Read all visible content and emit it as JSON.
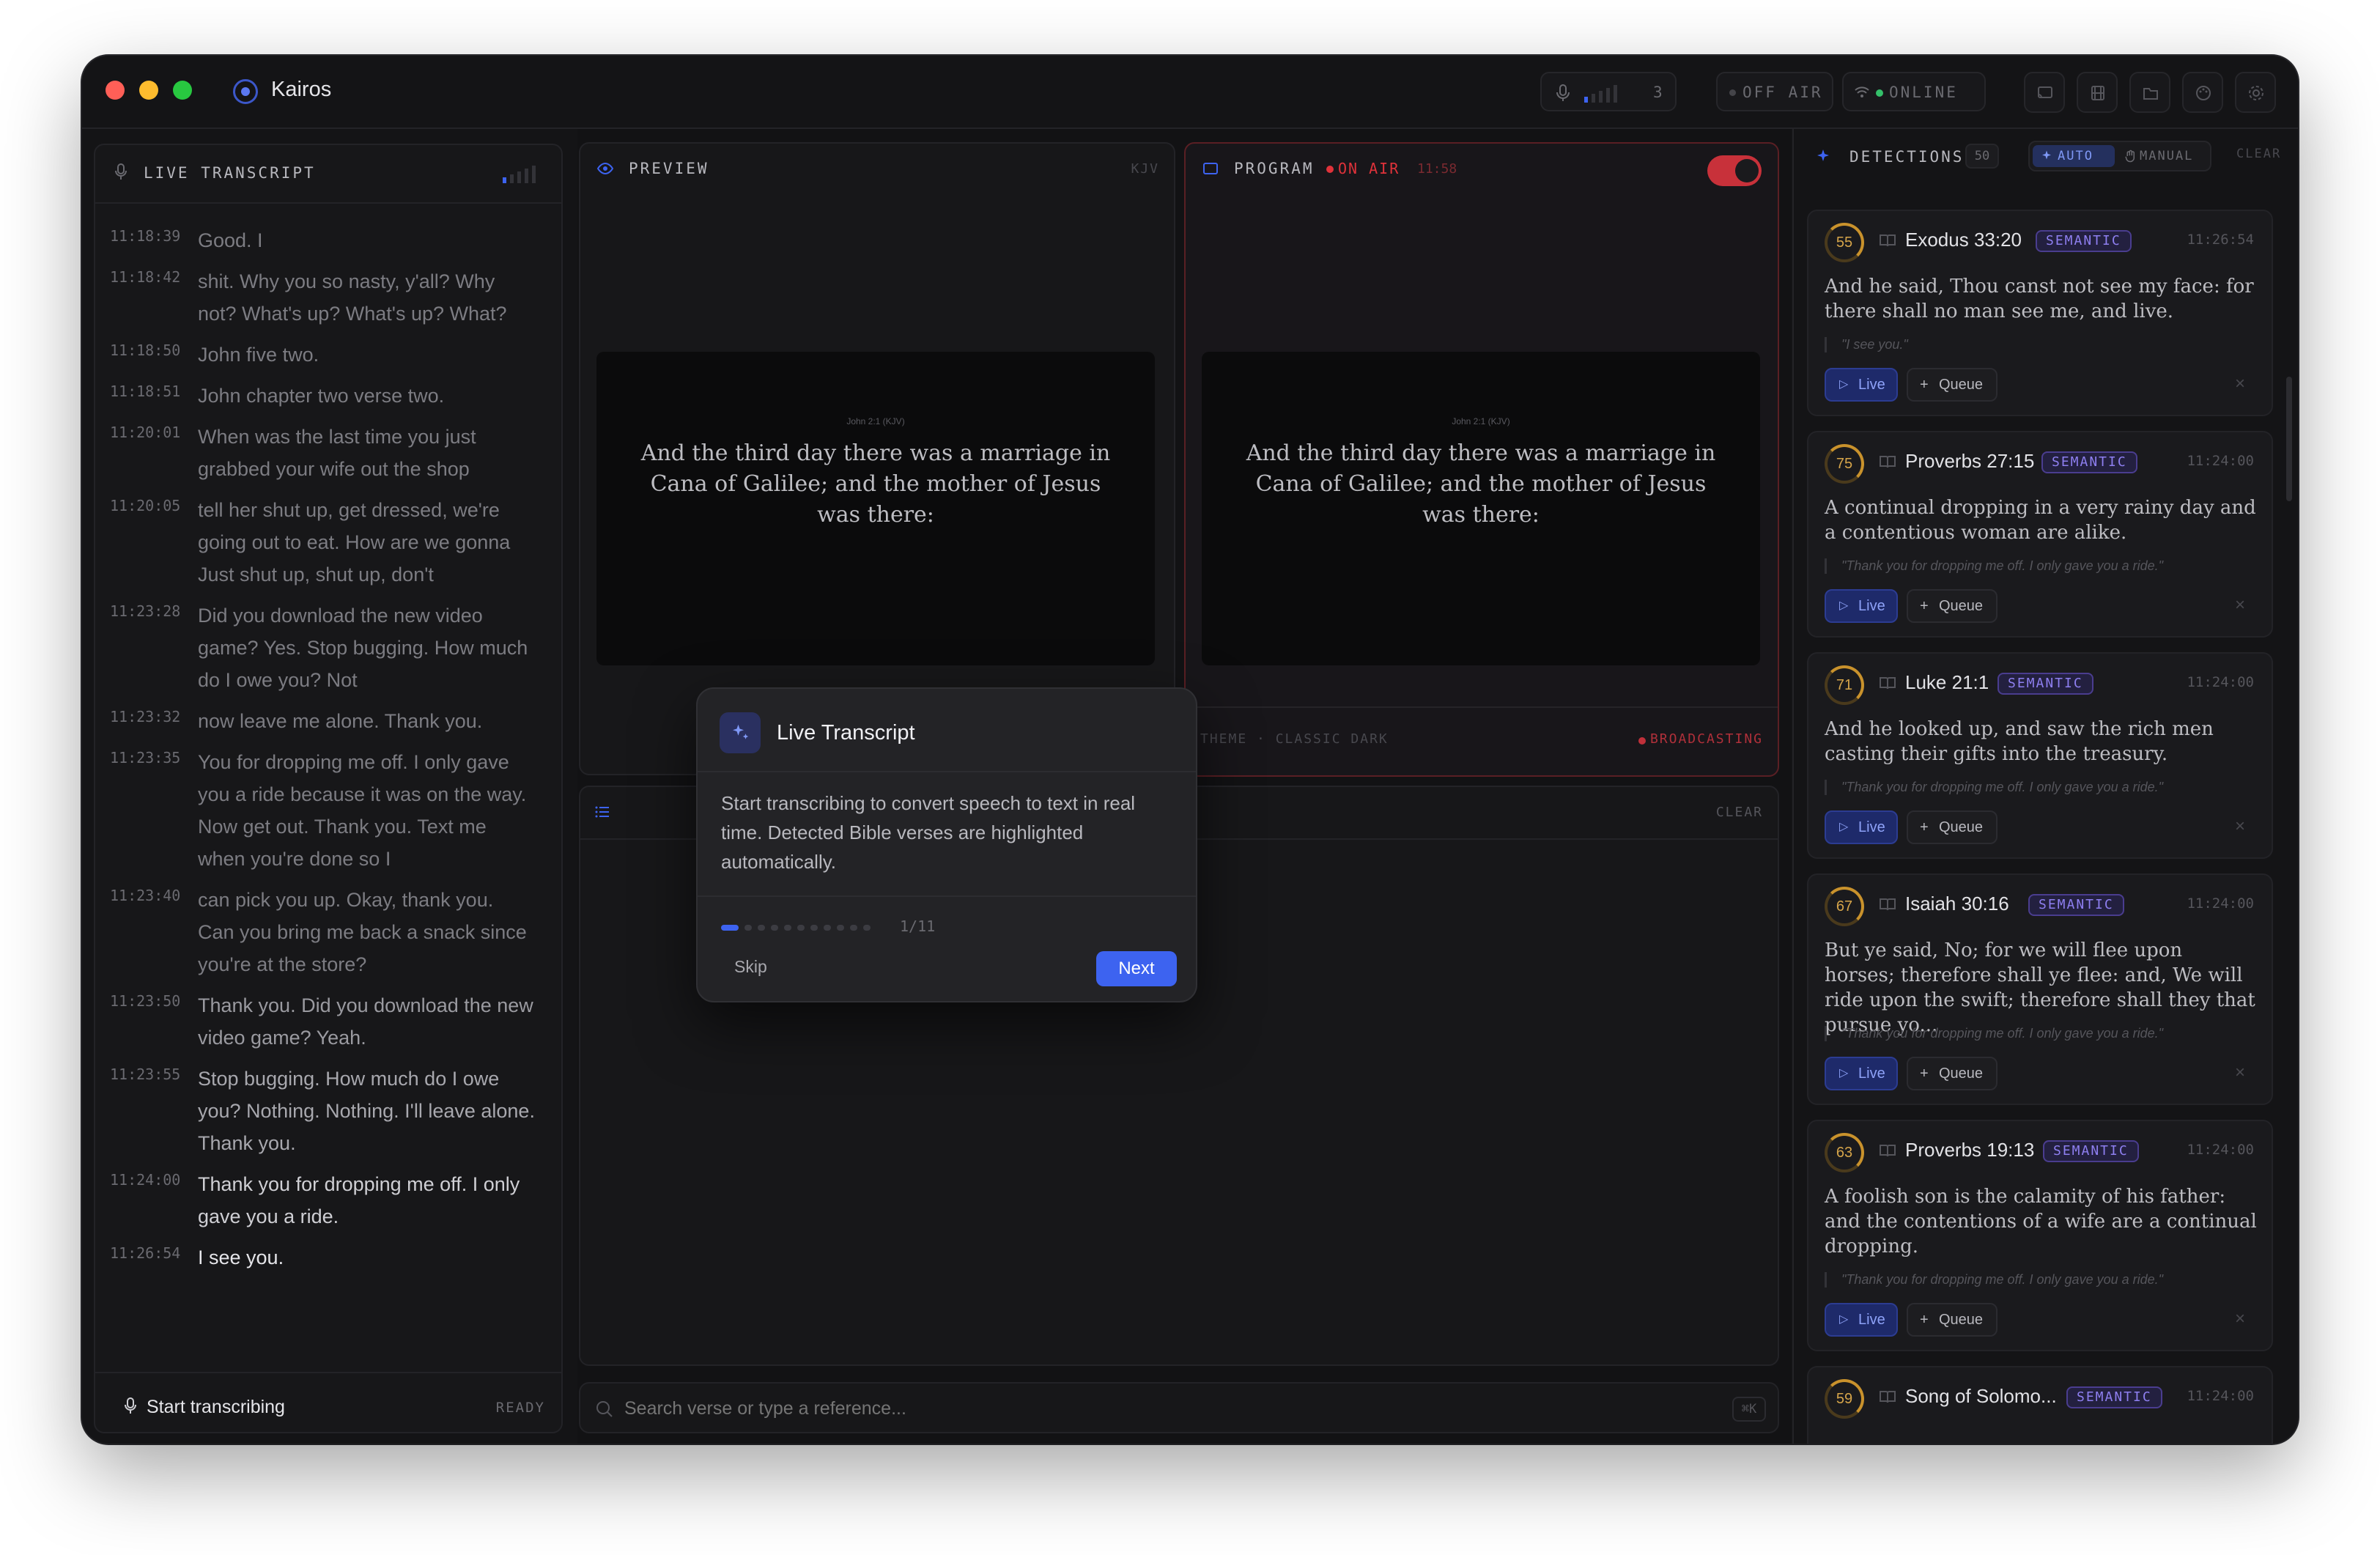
{
  "window": {
    "app_title": "Kairos",
    "colors": {
      "close": "#ff5f57",
      "minimize": "#febc2e",
      "zoom": "#28c840",
      "accent": "#3d63f0",
      "on_air": "#e0323a"
    }
  },
  "status": {
    "mic_count": "3",
    "off_air": "OFF AIR",
    "online": "ONLINE",
    "icons": [
      "cast-icon",
      "film-icon",
      "folder-icon",
      "palette-icon",
      "gear-icon"
    ]
  },
  "transcript": {
    "header": "LIVE TRANSCRIPT",
    "lines": [
      {
        "time": "11:18:39",
        "text": "Good. I"
      },
      {
        "time": "11:18:42",
        "text": "shit. Why you so nasty, y'all? Why not? What's up? What's up? What?"
      },
      {
        "time": "11:18:50",
        "text": "John five two."
      },
      {
        "time": "11:18:51",
        "text": "John chapter two verse two."
      },
      {
        "time": "11:20:01",
        "text": "When was the last time you just grabbed your wife out the shop"
      },
      {
        "time": "11:20:05",
        "text": "tell her shut up, get dressed, we're going out to eat. How are we gonna Just shut up, shut up, don't"
      },
      {
        "time": "11:23:28",
        "text": "Did you download the new video game? Yes. Stop bugging. How much do I owe you? Not"
      },
      {
        "time": "11:23:32",
        "text": "now leave me alone. Thank you."
      },
      {
        "time": "11:23:35",
        "text": "You for dropping me off. I only gave you a ride because it was on the way. Now get out. Thank you. Text me when you're done so I"
      },
      {
        "time": "11:23:40",
        "text": "can pick you up. Okay, thank you. Can you bring me back a snack since you're at the store?"
      },
      {
        "time": "11:23:50",
        "text": "Thank you. Did you download the new video game? Yeah."
      },
      {
        "time": "11:23:55",
        "text": "Stop bugging. How much do I owe you? Nothing. Nothing. I'll leave alone. Thank you."
      },
      {
        "time": "11:24:00",
        "text": "Thank you for dropping me off. I only gave you a ride."
      },
      {
        "time": "11:26:54",
        "text": "I see you."
      }
    ],
    "start_button": "Start transcribing",
    "ready": "READY"
  },
  "preview": {
    "header": "PREVIEW",
    "translation": "KJV",
    "slide_ref": "John 2:1 (KJV)",
    "slide_text": "And the third day there was a marriage in Cana of Galilee; and the mother of Jesus was there:"
  },
  "program": {
    "header": "PROGRAM",
    "on_air": "ON AIR",
    "on_air_time": "11:58",
    "slide_ref": "John 2:1 (KJV)",
    "slide_text": "And the third day there was a marriage in Cana of Galilee; and the mother of Jesus was there:",
    "theme": "THEME · CLASSIC DARK",
    "broadcasting": "BROADCASTING"
  },
  "queue": {
    "clear": "CLEAR"
  },
  "search": {
    "placeholder": "Search verse or type a reference...",
    "shortcut": "⌘K"
  },
  "detections": {
    "header": "DETECTIONS",
    "count": "50",
    "auto": "AUTO",
    "manual": "MANUAL",
    "clear": "CLEAR",
    "live_label": "Live",
    "queue_label": "Queue",
    "items": [
      {
        "score": "55",
        "ref": "Exodus 33:20",
        "badge": "SEMANTIC",
        "time": "11:26:54",
        "verse": "And he said, Thou canst not see my face: for there shall no man see me, and live.",
        "quote": "\"I see you.\""
      },
      {
        "score": "75",
        "ref": "Proverbs 27:15",
        "badge": "SEMANTIC",
        "time": "11:24:00",
        "verse": "A continual dropping in a very rainy day and a contentious woman are alike.",
        "quote": "\"Thank you for dropping me off. I only gave you a ride.\""
      },
      {
        "score": "71",
        "ref": "Luke 21:1",
        "badge": "SEMANTIC",
        "time": "11:24:00",
        "verse": "And he looked up, and saw the rich men casting their gifts into the treasury.",
        "quote": "\"Thank you for dropping me off. I only gave you a ride.\""
      },
      {
        "score": "67",
        "ref": "Isaiah 30:16",
        "badge": "SEMANTIC",
        "time": "11:24:00",
        "verse": "But ye said, No; for we will flee upon horses; therefore shall ye flee: and, We will ride upon the swift; therefore shall they that pursue yo...",
        "quote": "\"Thank you for dropping me off. I only gave you a ride.\""
      },
      {
        "score": "63",
        "ref": "Proverbs 19:13",
        "badge": "SEMANTIC",
        "time": "11:24:00",
        "verse": "A foolish son is the calamity of his father: and the contentions of a wife are a continual dropping.",
        "quote": "\"Thank you for dropping me off. I only gave you a ride.\""
      },
      {
        "score": "59",
        "ref": "Song of Solomo...",
        "badge": "SEMANTIC",
        "time": "11:24:00"
      }
    ]
  },
  "tour": {
    "title": "Live Transcript",
    "body": "Start transcribing to convert speech to text in real time. Detected Bible verses are highlighted automatically.",
    "step": "1/11",
    "progress": 0.09,
    "skip": "Skip",
    "next": "Next"
  }
}
